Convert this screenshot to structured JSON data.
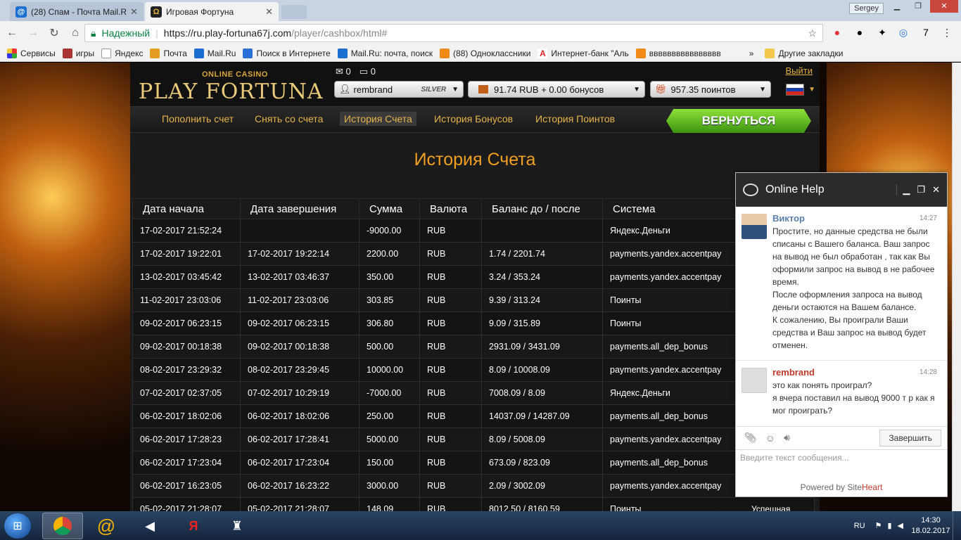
{
  "browser": {
    "tabs": [
      {
        "title": "(28) Спам - Почта Mail.R",
        "favicon": "mail-icon"
      },
      {
        "title": "Игровая Фортуна",
        "favicon": "fortuna-icon"
      }
    ],
    "user": "Sergey",
    "secure_label": "Надежный",
    "url_host": "https://ru.play-fortuna67j.com",
    "url_path": "/player/cashbox/html#",
    "bookmarks": [
      "Сервисы",
      "игры",
      "Яндекс",
      "Почта",
      "Mail.Ru",
      "Поиск в Интернете",
      "Mail.Ru: почта, поиск",
      "(88) Одноклассники",
      "Интернет-банк \"Аль",
      "вввввввввввввввв"
    ],
    "other_bookmarks": "Другие закладки"
  },
  "site": {
    "logo_top": "ONLINE CASINO",
    "logo": "PLAY FORTUNA",
    "messages_count": "0",
    "chat_count": "0",
    "logout": "Выйти",
    "username": "rembrand",
    "status": "SILVER",
    "balance": "91.74 RUB + 0.00 бонусов",
    "points": "957.35 поинтов",
    "nav": [
      "Пополнить счет",
      "Снять со счета",
      "История Счета",
      "История Бонусов",
      "История Поинтов"
    ],
    "back_button": "ВЕРНУТЬСЯ",
    "page_title": "История Счета"
  },
  "table": {
    "headers": [
      "Дата начала",
      "Дата завершения",
      "Сумма",
      "Валюта",
      "Баланс до / после",
      "Система"
    ],
    "rows": [
      [
        "17-02-2017 21:52:24",
        "",
        "-9000.00",
        "RUB",
        "",
        "Яндекс.Деньги"
      ],
      [
        "17-02-2017 19:22:01",
        "17-02-2017 19:22:14",
        "2200.00",
        "RUB",
        "1.74 / 2201.74",
        "payments.yandex.accentpay"
      ],
      [
        "13-02-2017 03:45:42",
        "13-02-2017 03:46:37",
        "350.00",
        "RUB",
        "3.24 / 353.24",
        "payments.yandex.accentpay"
      ],
      [
        "11-02-2017 23:03:06",
        "11-02-2017 23:03:06",
        "303.85",
        "RUB",
        "9.39 / 313.24",
        "Поинты"
      ],
      [
        "09-02-2017 06:23:15",
        "09-02-2017 06:23:15",
        "306.80",
        "RUB",
        "9.09 / 315.89",
        "Поинты"
      ],
      [
        "09-02-2017 00:18:38",
        "09-02-2017 00:18:38",
        "500.00",
        "RUB",
        "2931.09 / 3431.09",
        "payments.all_dep_bonus"
      ],
      [
        "08-02-2017 23:29:32",
        "08-02-2017 23:29:45",
        "10000.00",
        "RUB",
        "8.09 / 10008.09",
        "payments.yandex.accentpay"
      ],
      [
        "07-02-2017 02:37:05",
        "07-02-2017 10:29:19",
        "-7000.00",
        "RUB",
        "7008.09 / 8.09",
        "Яндекс.Деньги"
      ],
      [
        "06-02-2017 18:02:06",
        "06-02-2017 18:02:06",
        "250.00",
        "RUB",
        "14037.09 / 14287.09",
        "payments.all_dep_bonus"
      ],
      [
        "06-02-2017 17:28:23",
        "06-02-2017 17:28:41",
        "5000.00",
        "RUB",
        "8.09 / 5008.09",
        "payments.yandex.accentpay"
      ],
      [
        "06-02-2017 17:23:04",
        "06-02-2017 17:23:04",
        "150.00",
        "RUB",
        "673.09 / 823.09",
        "payments.all_dep_bonus"
      ],
      [
        "06-02-2017 16:23:05",
        "06-02-2017 16:23:22",
        "3000.00",
        "RUB",
        "2.09 / 3002.09",
        "payments.yandex.accentpay"
      ],
      [
        "05-02-2017 21:28:07",
        "05-02-2017 21:28:07",
        "148.09",
        "RUB",
        "8012.50 / 8160.59",
        "Поинты"
      ]
    ],
    "partial_status": "Успешная"
  },
  "chat": {
    "title": "Online Help",
    "messages": [
      {
        "who": "Виктор",
        "time": "14:27",
        "text": "Простите, но данные средства не были списаны с Вашего баланса. Ваш запрос на вывод не был обработан , так как Вы оформили запрос на вывод в не рабочее время.\nПосле оформления запроса на вывод деньги остаются на Вашем балансе.\nК сожалению, Вы проиграли Ваши средства и Ваш запрос на вывод будет отменен."
      },
      {
        "who": "rembrand",
        "time": "14:28",
        "text": "это как понять проиграл?\nя вчера поставил на вывод 9000 т р как я мог проиграть?"
      }
    ],
    "end_button": "Завершить",
    "input_placeholder": "Введите текст сообщения...",
    "powered_prefix": "Powered by ",
    "powered_site": "Site",
    "powered_heart": "Heart"
  },
  "taskbar": {
    "lang": "RU",
    "time": "14:30",
    "date": "18.02.2017"
  }
}
